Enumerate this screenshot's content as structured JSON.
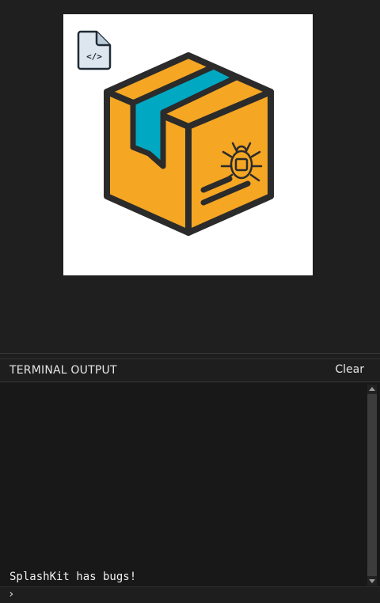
{
  "terminal": {
    "title": "TERMINAL OUTPUT",
    "clear_label": "Clear",
    "lines": [
      "SplashKit has bugs!"
    ],
    "prompt_symbol": "›",
    "input_value": ""
  },
  "canvas": {
    "icons": [
      "code-file-icon",
      "box-bug-icon"
    ],
    "background": "#ffffff"
  },
  "colors": {
    "box_orange": "#f5a623",
    "tape_teal": "#00a8c2",
    "outline": "#2b2b2b",
    "file_fill": "#dde6ee"
  }
}
